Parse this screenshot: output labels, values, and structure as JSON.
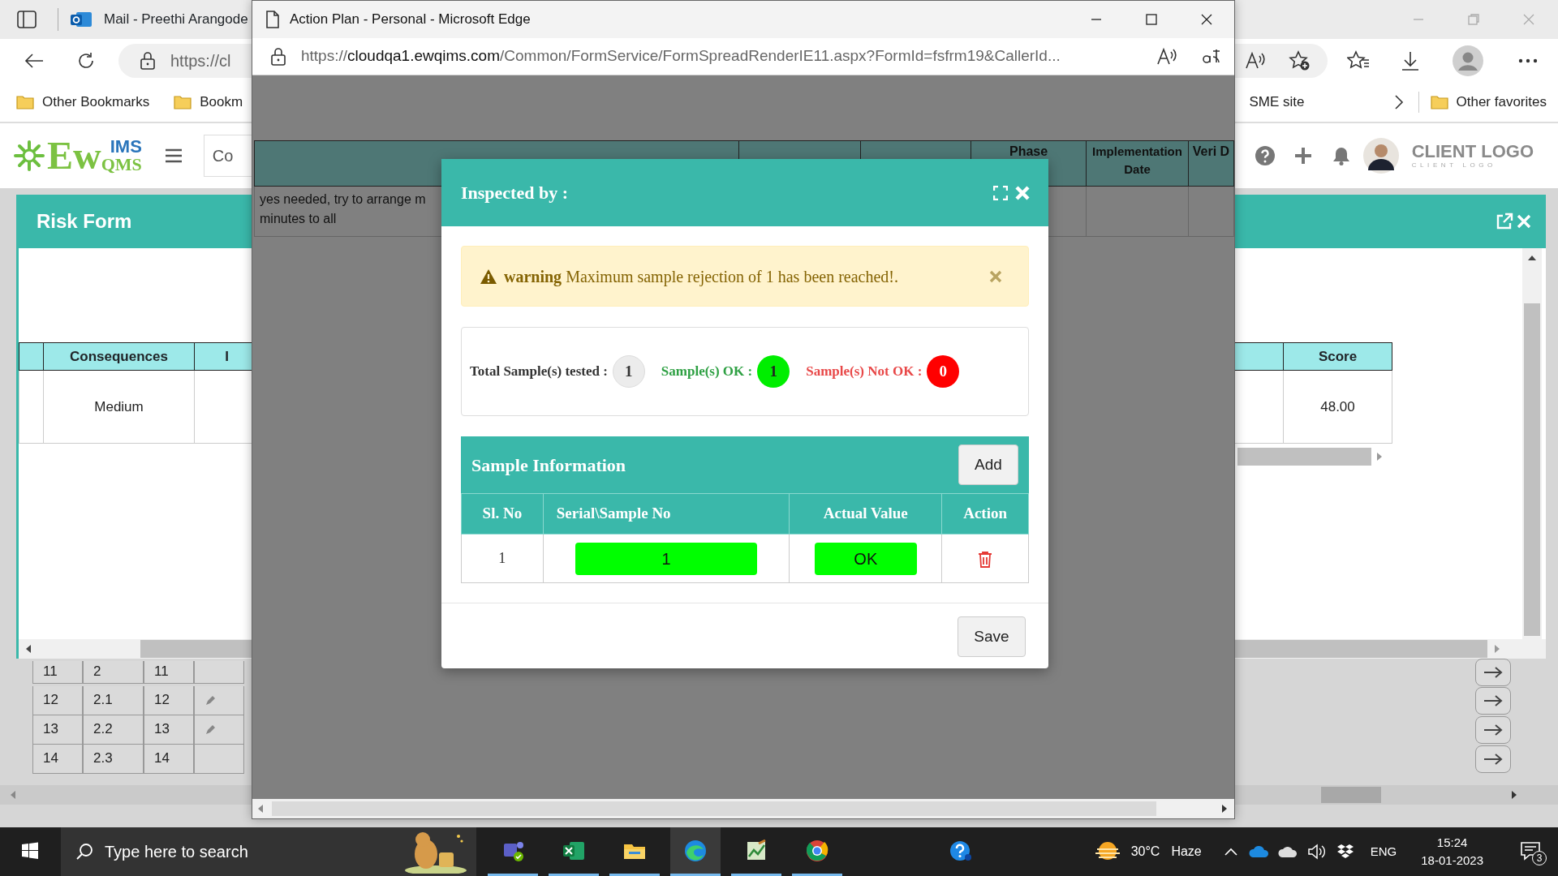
{
  "browser": {
    "tab_title": "Mail - Preethi Arangode",
    "url": "https://cl",
    "bookmarks": [
      {
        "label": "Other Bookmarks"
      },
      {
        "label": "Bookm"
      }
    ],
    "right_bookmarks": [
      {
        "label": "SME site",
        "kind": "link"
      },
      {
        "label": "Other favorites",
        "kind": "folder"
      }
    ]
  },
  "app_header": {
    "logo": {
      "mark": "Ew",
      "top": "IMS",
      "bottom": "QMS"
    },
    "search_value": "Co",
    "client_logo": "CLIENT LOGO",
    "client_logo_sub": "CLIENT LOGO"
  },
  "risk_form": {
    "title": "Risk Form",
    "left_columns": [
      "Consequences",
      "I"
    ],
    "left_row": [
      "Medium"
    ],
    "right_columns": [
      "Score"
    ],
    "right_row": [
      "48.00"
    ]
  },
  "background_grid": {
    "rows": [
      {
        "cells": [
          "11",
          "2",
          "11"
        ],
        "editable": false
      },
      {
        "cells": [
          "12",
          "2.1",
          "12"
        ],
        "editable": true
      },
      {
        "cells": [
          "13",
          "2.2",
          "13"
        ],
        "editable": true
      },
      {
        "cells": [
          "14",
          "2.3",
          "14"
        ],
        "editable": false
      }
    ]
  },
  "popup": {
    "title": "Action Plan - Personal - Microsoft Edge",
    "url_scheme": "https://",
    "url_host": "cloudqa1.ewqims.com",
    "url_path": "/Common/FormService/FormSpreadRenderIE11.aspx?FormId=fsfrm19&CallerId...",
    "table": {
      "columns": [
        "Phase",
        "Implementation Date",
        "Veri D"
      ],
      "row_lines": [
        "yes needed, try to arrange m",
        "minutes to all"
      ]
    }
  },
  "modal": {
    "title": "Inspected by :",
    "alert": "**warning** Maximum sample rejection of 1 has been reached!.",
    "counts": [
      {
        "kind": "total",
        "label": "Total Sample(s) tested :",
        "value": "1"
      },
      {
        "kind": "ok",
        "label": "Sample(s) OK :",
        "value": "1"
      },
      {
        "kind": "not_ok",
        "label": "Sample(s) Not OK :",
        "value": "0"
      }
    ],
    "section_title": "Sample Information",
    "add_label": "Add",
    "columns": [
      "Sl. No",
      "Serial\\Sample No",
      "Actual Value",
      "Action"
    ],
    "rows": [
      {
        "sl_no": "1",
        "serial": "1",
        "value": "OK",
        "passed": true
      }
    ],
    "save_label": "Save"
  },
  "taskbar": {
    "search_placeholder": "Type here to search",
    "apps": [
      {
        "kind": "teams",
        "running": true,
        "selected": false
      },
      {
        "kind": "excel",
        "running": true,
        "selected": false
      },
      {
        "kind": "explorer",
        "running": true,
        "selected": false
      },
      {
        "kind": "edge",
        "running": true,
        "selected": true
      },
      {
        "kind": "editor",
        "running": true,
        "selected": false
      },
      {
        "kind": "chrome",
        "running": true,
        "selected": false
      },
      {
        "kind": "help",
        "running": false,
        "selected": false
      }
    ],
    "temperature": "30°C",
    "weather": "Haze",
    "language": "ENG",
    "time": "15:24",
    "date": "18-01-2023",
    "notifications": "3"
  }
}
